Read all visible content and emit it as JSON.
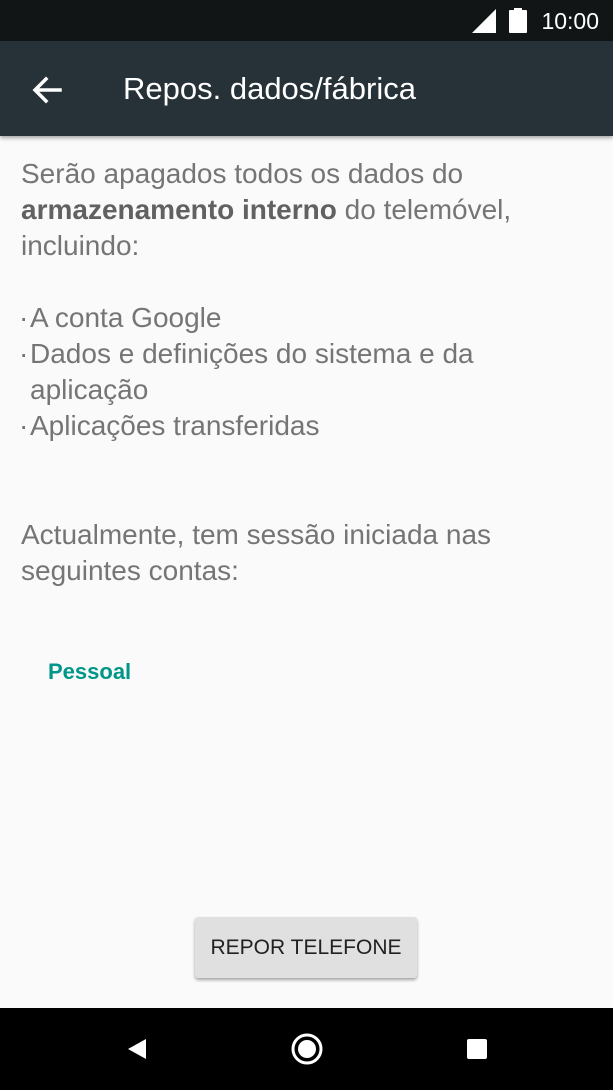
{
  "status_bar": {
    "time": "10:00",
    "icons": [
      "signal-icon",
      "battery-icon"
    ]
  },
  "app_bar": {
    "title": "Repos. dados/fábrica",
    "back_icon": "arrow-back-icon"
  },
  "warning": {
    "line1": "Serão apagados todos os dados do",
    "bold": "armazenamento interno",
    "after_bold": " do telemóvel,",
    "line3": "incluindo:",
    "items": [
      "A conta Google",
      "Dados e definições do sistema e da aplicação",
      "Aplicações transferidas"
    ]
  },
  "sessions_text": "Actualmente, tem sessão iniciada nas seguintes contas:",
  "account": "Pessoal",
  "reset_button": "REPOR TELEFONE",
  "nav_bar": {
    "icons": [
      "back-triangle-icon",
      "home-circle-icon",
      "recents-square-icon"
    ]
  },
  "colors": {
    "app_bar": "#263238",
    "status_bar": "#111516",
    "accent": "#009688",
    "text_secondary": "#757575",
    "button_bg": "#e0e0e0"
  }
}
